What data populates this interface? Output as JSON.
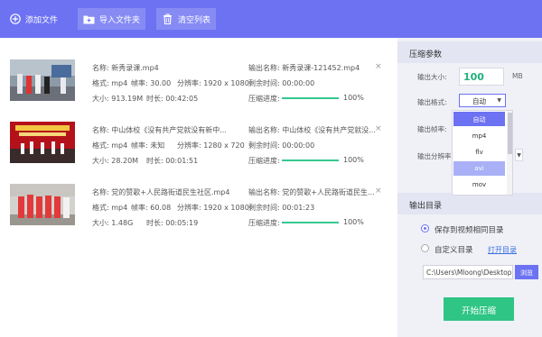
{
  "toolbar": {
    "add_file": "添加文件",
    "import_folder": "导入文件夹",
    "clear_list": "清空列表",
    "accent_color": "#6c72f2"
  },
  "files": [
    {
      "name_label": "名称:",
      "name": "新秀录课.mp4",
      "out_label": "输出名称:",
      "out_name": "新秀录课-121452.mp4",
      "format_label": "格式:",
      "format": "mp4",
      "fps_label": "帧率:",
      "fps": "30.00",
      "res_label": "分辨率:",
      "res": "1920 x 1080",
      "remain_label": "剩余时间:",
      "remain": "00:00:00",
      "size_label": "大小:",
      "size": "913.19M",
      "dur_label": "时长:",
      "dur": "00:42:05",
      "prog_label": "压缩进度:",
      "progress": "100%",
      "progress_value": 1.0
    },
    {
      "name_label": "名称:",
      "name": "中山体校《没有共产党就没有新中...",
      "out_label": "输出名称:",
      "out_name": "中山体校《没有共产党就没...",
      "format_label": "格式:",
      "format": "mp4",
      "fps_label": "帧率:",
      "fps": "未知",
      "res_label": "分辨率:",
      "res": "1280 x 720",
      "remain_label": "剩余时间:",
      "remain": "00:00:00",
      "size_label": "大小:",
      "size": "28.20M",
      "dur_label": "时长:",
      "dur": "00:01:51",
      "prog_label": "压缩进度:",
      "progress": "100%",
      "progress_value": 1.0
    },
    {
      "name_label": "名称:",
      "name": "党的赞歌+人民路街道民生社区.mp4",
      "out_label": "输出名称:",
      "out_name": "党的赞歌+人民路街道民生...",
      "format_label": "格式:",
      "format": "mp4",
      "fps_label": "帧率:",
      "fps": "60.08",
      "res_label": "分辨率:",
      "res": "1920 x 1080",
      "remain_label": "剩余时间:",
      "remain": "00:01:23",
      "size_label": "大小:",
      "size": "1.48G",
      "dur_label": "时长:",
      "dur": "00:05:19",
      "prog_label": "压缩进度:",
      "progress": "100%",
      "progress_value": 1.0
    }
  ],
  "close_symbol": "×",
  "settings": {
    "title": "压缩参数",
    "size_label": "输出大小:",
    "size_value": "100",
    "size_unit": "MB",
    "format_label": "输出格式:",
    "format_value": "自动",
    "fps_label": "输出帧率:",
    "res_label": "输出分辨率:",
    "format_options": [
      "自动",
      "mp4",
      "flv",
      "avi",
      "mov",
      "..."
    ]
  },
  "output": {
    "title": "输出目录",
    "same_dir_label": "保存到视频相同目录",
    "custom_dir_label": "自定义目录",
    "open_dir_link": "打开目录",
    "path": "C:\\Users\\Mloong\\Desktop",
    "browse_label": "浏览",
    "selected": "same_dir"
  },
  "start_label": "开始压缩",
  "colors": {
    "progress": "#35c98f",
    "start": "#2fc585",
    "panel": "#f0f1f7"
  }
}
